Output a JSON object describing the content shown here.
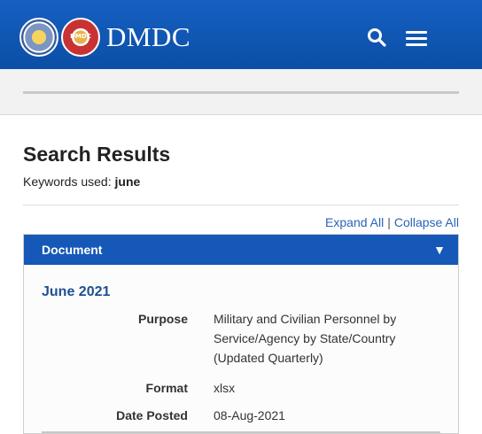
{
  "header": {
    "brand": "DMDC",
    "seal_dod_label": "DoD seal",
    "seal_dmdc_label": "DMDC",
    "search_icon": "search-icon",
    "menu_icon": "hamburger-menu-icon",
    "bg_color": "#0b4ea6"
  },
  "results": {
    "title": "Search Results",
    "keywords_label": "Keywords used:",
    "keywords_value": "june",
    "expand_all": "Expand All",
    "separator": "|",
    "collapse_all": "Collapse All"
  },
  "document_table": {
    "header_label": "Document",
    "toggle_glyph": "▼",
    "entry": {
      "title": "June 2021",
      "fields": [
        {
          "label": "Purpose",
          "value": "Military and Civilian Personnel by Service/Agency by State/Country (Updated Quarterly)"
        },
        {
          "label": "Format",
          "value": "xlsx"
        },
        {
          "label": "Date Posted",
          "value": "08-Aug-2021"
        }
      ]
    }
  }
}
